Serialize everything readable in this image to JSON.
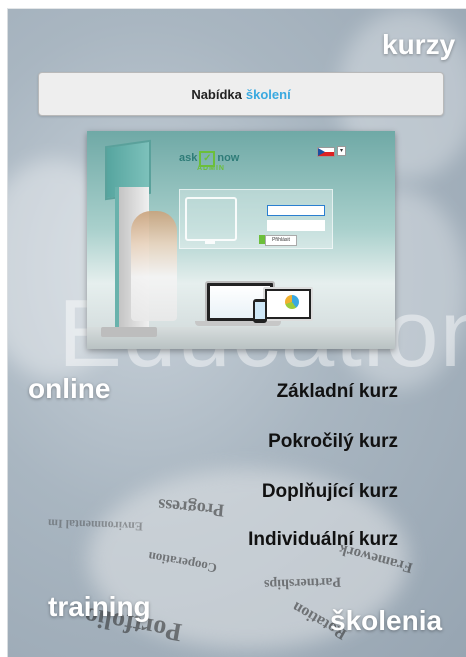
{
  "corner_words": {
    "top_right": "kurzy",
    "left_middle": "online",
    "bottom_left": "training",
    "bottom_right": "školenia"
  },
  "banner": {
    "prefix": "Nabídka",
    "accent": "školení",
    "accent_color": "#3aa9e0"
  },
  "screenshot": {
    "logo_left": "ask",
    "logo_right": "now",
    "logo_sub": "ADMIN",
    "login_button": "Přihlásit",
    "language_flag": "cz-flag-icon"
  },
  "watermark": "Education",
  "background_words": [
    "Progress",
    "Environmental Im",
    "Framework",
    "Cooperation",
    "Partnerships",
    "Portfolio",
    "Rotation"
  ],
  "courses": [
    {
      "label": "Základní kurz"
    },
    {
      "label": "Pokročilý kurz"
    },
    {
      "label": "Doplňující kurz"
    },
    {
      "label": "Individuální kurz"
    }
  ]
}
